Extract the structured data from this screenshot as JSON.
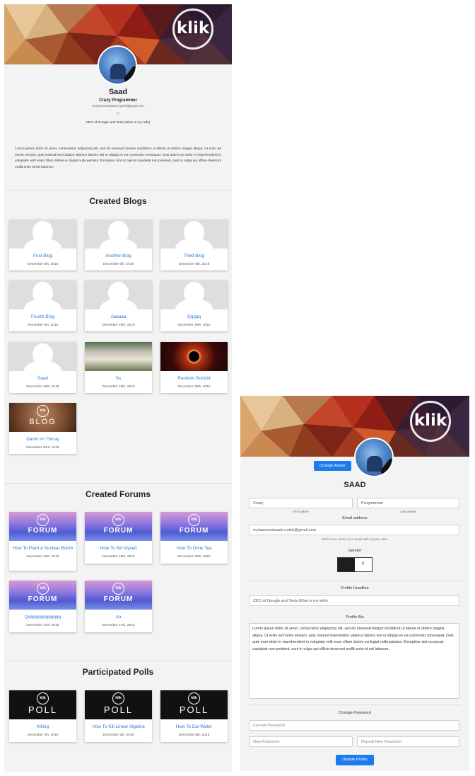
{
  "profile": {
    "name": "Saad",
    "title": "Crazy Programmer",
    "email": "muhammadsaad.crytek@gmail.com",
    "headline": "CEO of Google and Tesla (Elon is my wife)",
    "bio": "Lorem ipsum dolor sit amet, consectetur adipiscing elit, sed do eiusmod tempor incididunt ut labore et dolore magna aliqua. Ut enim ad minim veniam, quis nostrud exercitation ullamco laboris nisi ut aliquip ex ea commodo consequat. Duis aute irure dolor in reprehenderit in voluptate velit esse cillum dolore eu fugiat nulla pariatur. Excepteur sint occaecat cupidatat non proident, sunt in culpa qui officia deserunt mollit anim id est laborum."
  },
  "logo_text": "klik",
  "blogs": {
    "heading": "Created Blogs",
    "items": [
      {
        "title": "First Blog",
        "date": "December 6th, 2018",
        "thumb": "placeholder"
      },
      {
        "title": "Another Blog",
        "date": "December 6th, 2018",
        "thumb": "placeholder"
      },
      {
        "title": "Third Blog",
        "date": "December 6th, 2018",
        "thumb": "placeholder"
      },
      {
        "title": "Fourth Blog",
        "date": "December 8th, 2018",
        "thumb": "placeholder"
      },
      {
        "title": "Aaaaaa",
        "date": "December 19th, 2018",
        "thumb": "placeholder"
      },
      {
        "title": "Qqqqq",
        "date": "December 19th, 2018",
        "thumb": "placeholder"
      },
      {
        "title": "Saad",
        "date": "December 19th, 2018",
        "thumb": "placeholder"
      },
      {
        "title": "Ss",
        "date": "December 19th, 2018",
        "thumb": "kaaba"
      },
      {
        "title": "Random Bullshit",
        "date": "December 20th, 2018",
        "thumb": "eclipse"
      },
      {
        "title": "Damn im Thirsty",
        "date": "December 23rd, 2018",
        "thumb": "blog",
        "thumb_text": "BLOG"
      }
    ]
  },
  "forums": {
    "heading": "Created Forums",
    "thumb_text": "FORUM",
    "items": [
      {
        "title": "How To Plant A Nuclear Bomb",
        "date": "November 16th, 2018"
      },
      {
        "title": "How To Kill Myself",
        "date": "November 18th, 2018"
      },
      {
        "title": "How To Drink Tea",
        "date": "December 16th, 2018"
      },
      {
        "title": "Qqqqqqqqqqqqqq",
        "date": "December 17th, 2018"
      },
      {
        "title": "Aa",
        "date": "December 17th, 2018"
      }
    ]
  },
  "polls": {
    "heading": "Participated Polls",
    "thumb_text": "POLL",
    "items": [
      {
        "title": "Killing",
        "date": "December 4th, 2018"
      },
      {
        "title": "How To Kill Linear Algebra",
        "date": "December 5th, 2018"
      },
      {
        "title": "How To Eat Water",
        "date": "December 5th, 2018"
      }
    ]
  },
  "edit": {
    "change_avatar_label": "Change Avatar",
    "display_name": "SAAD",
    "first_name_value": "Crazy",
    "last_name_value": "Programmer",
    "first_name_label": "First Name",
    "last_name_label": "Last Name",
    "email_label": "Email address",
    "email_value": "muhammadsaad.crytek@gmail.com",
    "email_help": "We'll never share your email with anyone else.",
    "gender_label": "Gender",
    "gender_options": [
      "M",
      "F"
    ],
    "gender_selected": "M",
    "headline_label": "Profile Headline",
    "headline_value": "CEO of Google and Tesla (Elon is my wife)",
    "bio_label": "Profile Bio",
    "bio_value": "Lorem ipsum dolor sit amet, consectetur adipiscing elit, sed do eiusmod tempor incididunt ut labore et dolore magna aliqua. Ut enim ad minim veniam, quis nostrud exercitation ullamco laboris nisi ut aliquip ex ea commodo consequat. Duis aute irure dolor in reprehenderit in voluptate velit esse cillum dolore eu fugiat nulla pariatur. Excepteur sint occaecat cupidatat non proident, sunt in culpa qui officia deserunt mollit anim id est laborum.",
    "change_password_label": "Change Password",
    "current_password_placeholder": "Current Password",
    "new_password_placeholder": "New Password",
    "repeat_password_placeholder": "Repeat New Password",
    "update_label": "Update Profile"
  },
  "colors": {
    "accent": "#1d7bf0",
    "link": "#2a7ad8",
    "panel": "#f3f3f3"
  }
}
